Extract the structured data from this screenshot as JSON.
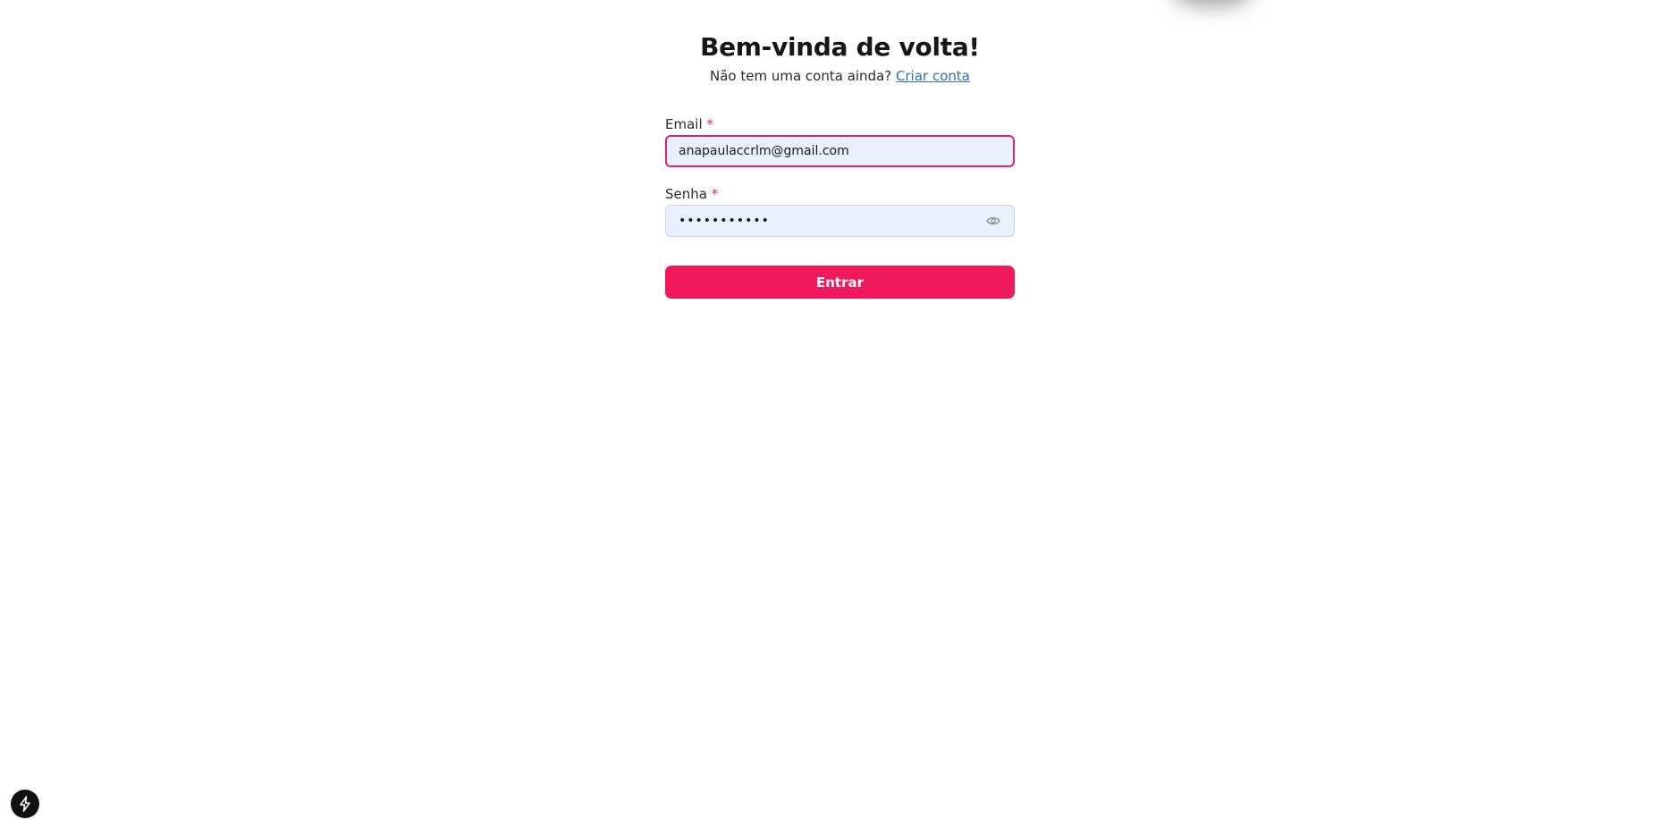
{
  "header": {
    "title": "Bem-vinda de volta!",
    "subtitle_prefix": "Não tem uma conta ainda?",
    "signup_link": "Criar conta"
  },
  "form": {
    "email": {
      "label": "Email",
      "required_mark": "*",
      "value": "anapaulaccrlm@gmail.com"
    },
    "password": {
      "label": "Senha",
      "required_mark": "*",
      "masked_value": "•••••••••••",
      "toggle_icon": "eye-icon"
    },
    "submit_label": "Entrar"
  },
  "corner_badge": {
    "icon": "lightning-icon"
  },
  "colors": {
    "accent": "#f0195c",
    "link": "#2f6fb3",
    "input_bg": "#e8f0fe",
    "focus_border": "#e0246b"
  }
}
